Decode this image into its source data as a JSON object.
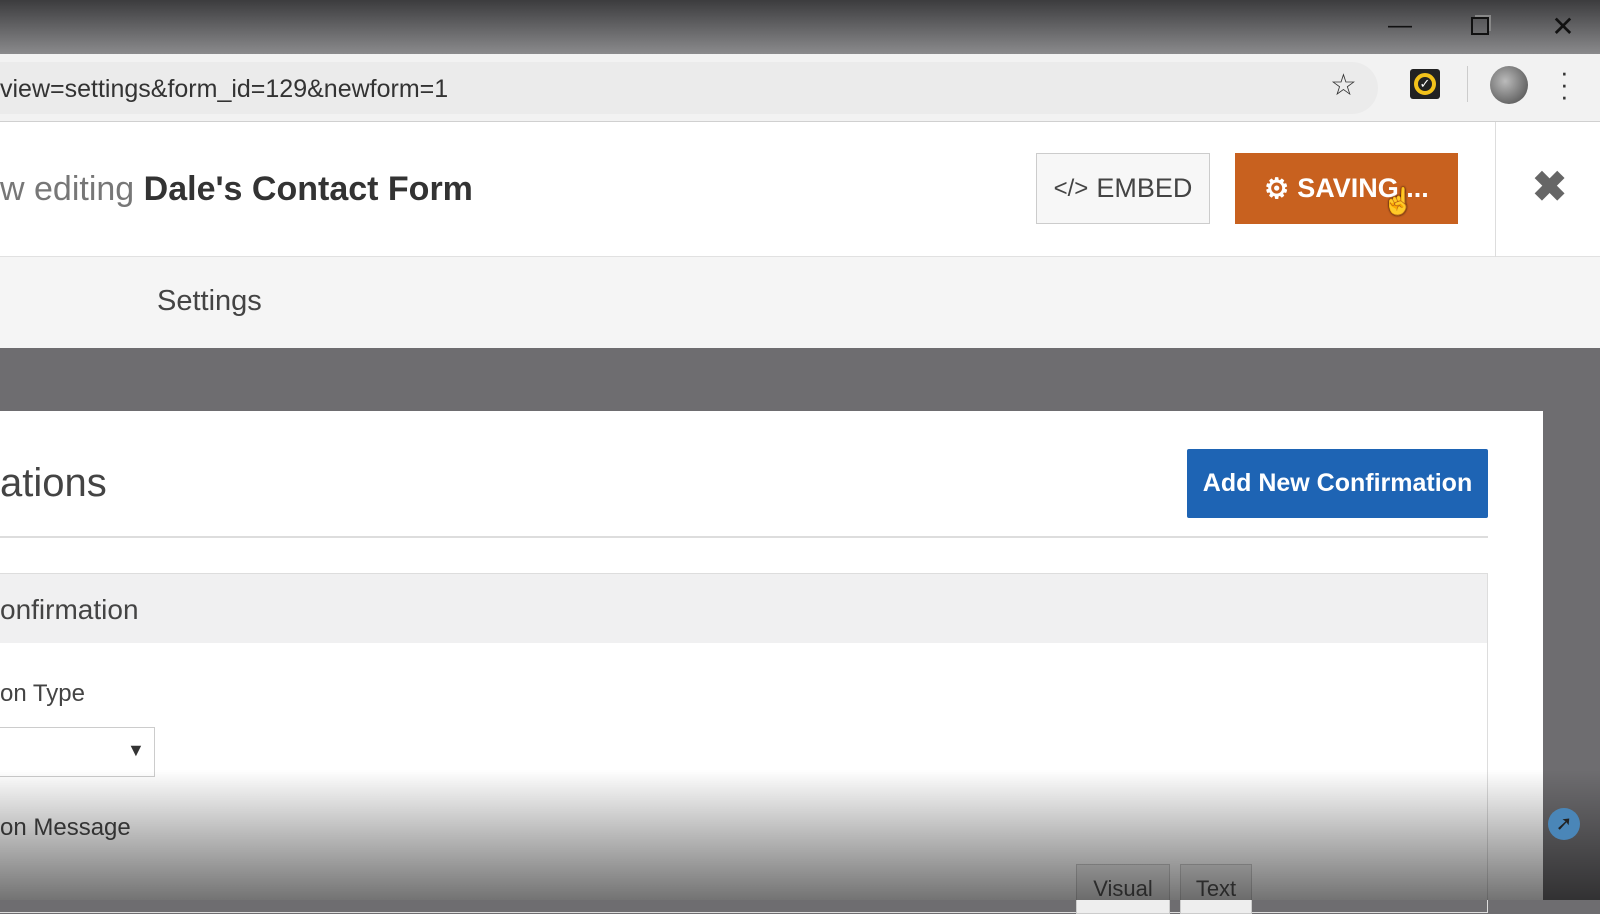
{
  "browser": {
    "url": "view=settings&form_id=129&newform=1",
    "icons": [
      "minimize-icon",
      "restore-icon",
      "close-icon",
      "star-icon",
      "norton-extension-icon",
      "profile-avatar",
      "menu-dots-icon"
    ]
  },
  "header": {
    "prefix": "w editing",
    "form_name": "Dale's Contact Form",
    "embed_label": "EMBED",
    "saving_label": "SAVING ...",
    "close_icon": "close-icon"
  },
  "tabs": {
    "settings": "Settings"
  },
  "panel": {
    "title": "ations",
    "add_button": "Add New Confirmation",
    "section_title": "onfirmation",
    "type_label": "on Type",
    "message_label": "on Message",
    "editor_tabs": [
      "Visual",
      "Text"
    ]
  },
  "colors": {
    "saving": "#c8611f",
    "add": "#1e64b4"
  }
}
